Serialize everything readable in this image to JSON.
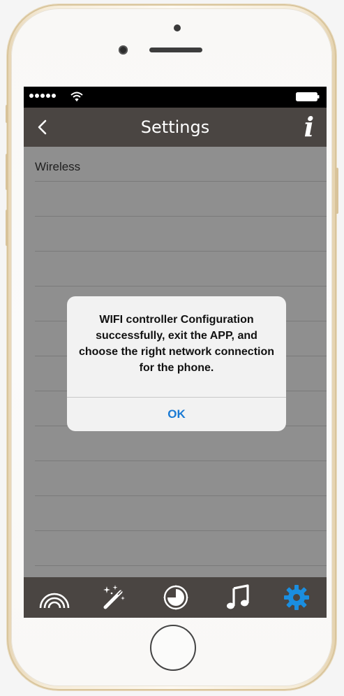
{
  "nav": {
    "title": "Settings",
    "back_icon": "chevron-left-icon",
    "info_icon": "info-icon",
    "info_glyph": "i"
  },
  "status_bar": {
    "signal_dots": 5,
    "icons": [
      "signal-dots-icon",
      "wifi-icon",
      "battery-icon"
    ]
  },
  "list": {
    "items": [
      {
        "label": "Wireless"
      },
      {
        "label": ""
      },
      {
        "label": ""
      },
      {
        "label": ""
      },
      {
        "label": ""
      },
      {
        "label": ""
      },
      {
        "label": ""
      },
      {
        "label": ""
      },
      {
        "label": ""
      },
      {
        "label": ""
      },
      {
        "label": ""
      },
      {
        "label": ""
      }
    ]
  },
  "dialog": {
    "message": "WIFI controller Configuration successfully, exit the APP, and choose the right network connection for the phone.",
    "ok_label": "OK"
  },
  "tab_bar": {
    "tabs": [
      {
        "icon": "rainbow-icon"
      },
      {
        "icon": "magic-wand-icon"
      },
      {
        "icon": "timer-icon"
      },
      {
        "icon": "music-note-icon"
      },
      {
        "icon": "gear-icon",
        "active": true
      }
    ],
    "active_color": "#1a8ee0",
    "inactive_color": "#ffffff"
  },
  "colors": {
    "nav_bg": "#4a4542",
    "list_bg": "#8f8f8f",
    "dialog_bg": "#f2f2f2",
    "accent": "#1a7ad4"
  }
}
